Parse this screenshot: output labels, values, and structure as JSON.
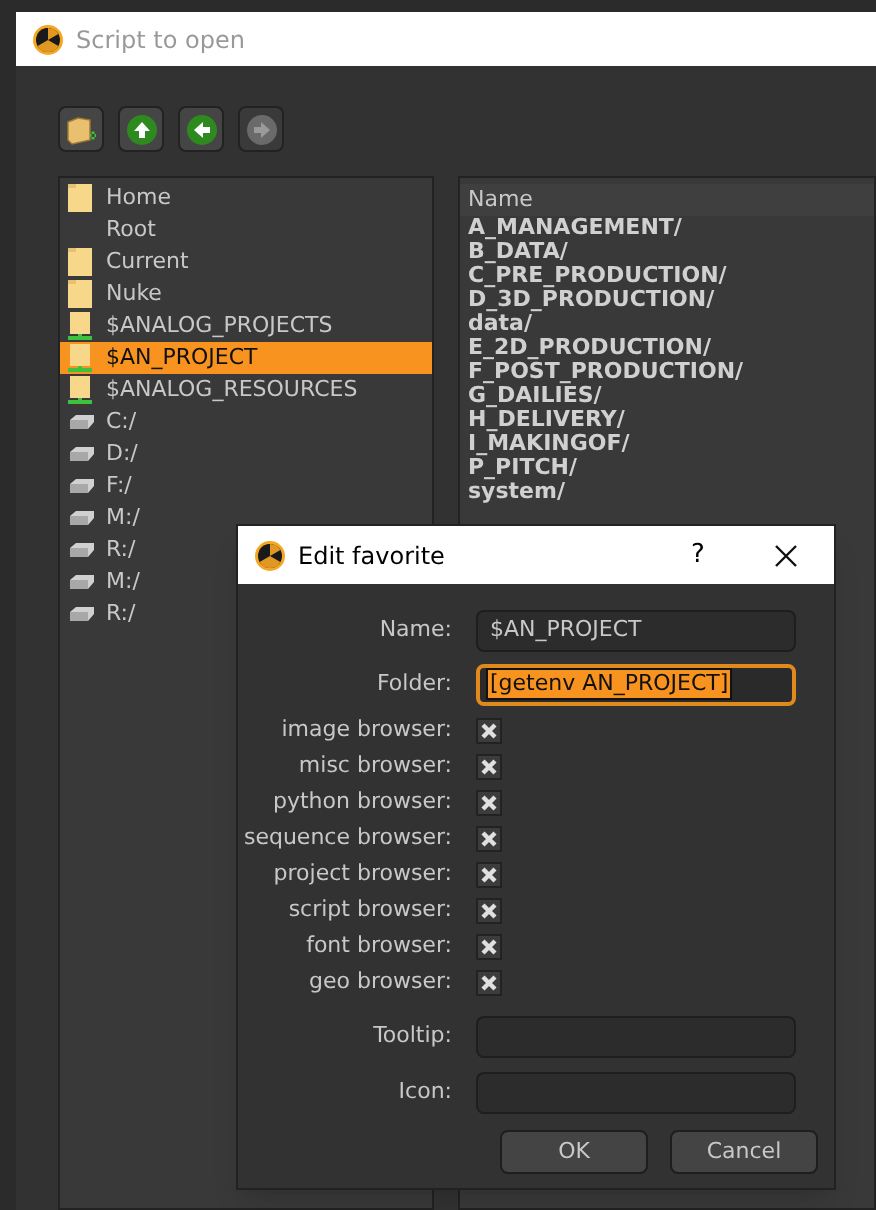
{
  "window": {
    "title": "Script to open"
  },
  "toolbar": [
    {
      "kind": "new-folder",
      "disabled": false
    },
    {
      "kind": "up",
      "disabled": false
    },
    {
      "kind": "back",
      "disabled": false
    },
    {
      "kind": "forward",
      "disabled": true
    }
  ],
  "favorites": [
    {
      "label": "Home",
      "kind": "folder",
      "selected": false
    },
    {
      "label": "Root",
      "kind": "none",
      "selected": false
    },
    {
      "label": "Current",
      "kind": "folder",
      "selected": false
    },
    {
      "label": "Nuke",
      "kind": "folder",
      "selected": false
    },
    {
      "label": "$ANALOG_PROJECTS",
      "kind": "env",
      "selected": false
    },
    {
      "label": "$AN_PROJECT",
      "kind": "env",
      "selected": true
    },
    {
      "label": "$ANALOG_RESOURCES",
      "kind": "env",
      "selected": false
    },
    {
      "label": "C:/",
      "kind": "drive",
      "selected": false
    },
    {
      "label": "D:/",
      "kind": "drive",
      "selected": false
    },
    {
      "label": "F:/",
      "kind": "drive",
      "selected": false
    },
    {
      "label": "M:/",
      "kind": "drive",
      "selected": false
    },
    {
      "label": "R:/",
      "kind": "drive",
      "selected": false
    },
    {
      "label": "M:/",
      "kind": "drive",
      "selected": false
    },
    {
      "label": "R:/",
      "kind": "drive",
      "selected": false
    }
  ],
  "files": {
    "column": "Name",
    "rows": [
      "A_MANAGEMENT/",
      "B_DATA/",
      "C_PRE_PRODUCTION/",
      "D_3D_PRODUCTION/",
      "data/",
      "E_2D_PRODUCTION/",
      "F_POST_PRODUCTION/",
      "G_DAILIES/",
      "H_DELIVERY/",
      "I_MAKINGOF/",
      "P_PITCH/",
      "system/"
    ]
  },
  "dialog": {
    "title": "Edit favorite",
    "help": "?",
    "name": {
      "label": "Name:",
      "value": "$AN_PROJECT"
    },
    "folder": {
      "label": "Folder:",
      "value": "[getenv AN_PROJECT]",
      "selected": true
    },
    "checks": [
      {
        "label": "image browser:",
        "checked": true
      },
      {
        "label": "misc browser:",
        "checked": true
      },
      {
        "label": "python browser:",
        "checked": true
      },
      {
        "label": "sequence browser:",
        "checked": true
      },
      {
        "label": "project browser:",
        "checked": true
      },
      {
        "label": "script browser:",
        "checked": true
      },
      {
        "label": "font browser:",
        "checked": true
      },
      {
        "label": "geo browser:",
        "checked": true
      }
    ],
    "tooltip": {
      "label": "Tooltip:"
    },
    "icon": {
      "label": "Icon:"
    },
    "buttons": [
      "OK",
      "Cancel"
    ]
  }
}
